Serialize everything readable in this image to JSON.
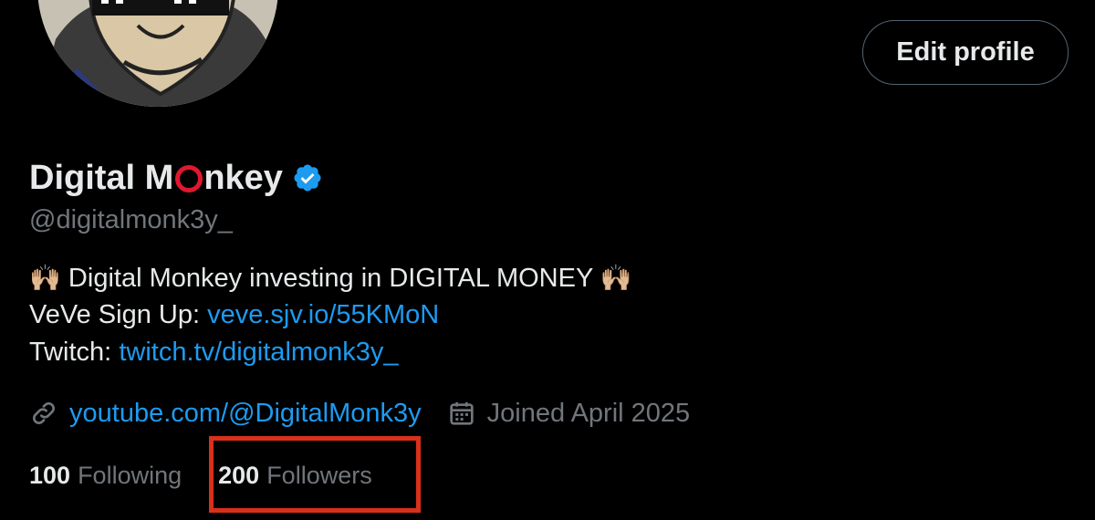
{
  "profile": {
    "display_name_before": "Digital M",
    "display_name_after": "nkey",
    "handle": "@digitalmonk3y_",
    "verified": true,
    "edit_button_label": "Edit profile",
    "bio": {
      "line1_emoji_left": "🙌🏼",
      "line1_text": " Digital Monkey investing in DIGITAL MONEY ",
      "line1_emoji_right": "🙌🏼",
      "line2_label": "VeVe Sign Up: ",
      "line2_link": "veve.sjv.io/55KMoN",
      "line3_label": "Twitch: ",
      "line3_link": "twitch.tv/digitalmonk3y_"
    },
    "website_link": "youtube.com/@DigitalMonk3y",
    "joined": "Joined April 2025",
    "following_count": "100",
    "following_label": "Following",
    "followers_count": "200",
    "followers_label": "Followers"
  },
  "icons": {
    "link": "link-icon",
    "calendar": "calendar-icon",
    "verified": "verified-badge-icon"
  },
  "colors": {
    "background": "#000000",
    "text_primary": "#e7e9ea",
    "text_secondary": "#71767b",
    "link": "#1d9bf0",
    "verified": "#1d9bf0",
    "highlight_box": "#d9301c",
    "name_o_ring": "#e0182d"
  }
}
